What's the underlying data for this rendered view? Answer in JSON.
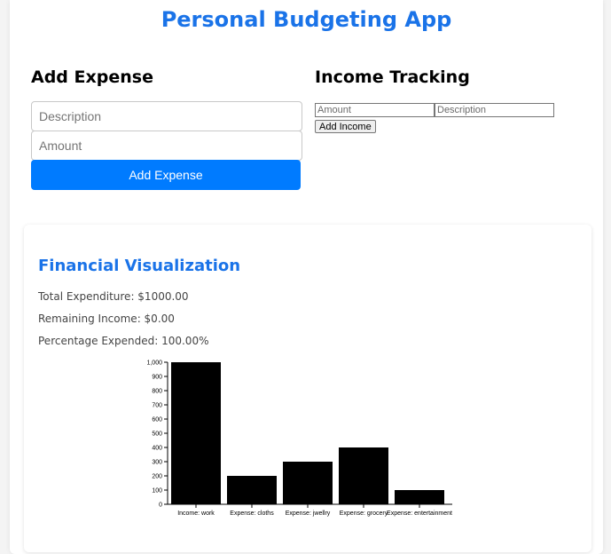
{
  "app": {
    "title": "Personal Budgeting App"
  },
  "expense_form": {
    "heading": "Add Expense",
    "description_placeholder": "Description",
    "amount_placeholder": "Amount",
    "submit_label": "Add Expense",
    "button_color": "#007bff"
  },
  "income_form": {
    "heading": "Income Tracking",
    "amount_placeholder": "Amount",
    "description_placeholder": "Description",
    "submit_label": "Add Income"
  },
  "visualization": {
    "heading": "Financial Visualization",
    "total_expenditure": "Total Expenditure: $1000.00",
    "remaining_income": "Remaining Income: $0.00",
    "percentage_expended": "Percentage Expended: 100.00%"
  },
  "colors": {
    "accent": "#1a73e8",
    "bar": "#000000"
  },
  "chart_data": {
    "type": "bar",
    "categories": [
      "Income: work",
      "Expense: cloths",
      "Expense: jwellry",
      "Expense: grocery",
      "Expense: entertainment"
    ],
    "values": [
      1000,
      200,
      300,
      400,
      100
    ],
    "ylim": [
      0,
      1000
    ],
    "yticks": [
      0,
      100,
      200,
      300,
      400,
      500,
      600,
      700,
      800,
      900,
      1000
    ],
    "ytick_labels": [
      "0",
      "100",
      "200",
      "300",
      "400",
      "500",
      "600",
      "700",
      "800",
      "900",
      "1,000"
    ],
    "grid": false,
    "title": "",
    "xlabel": "",
    "ylabel": ""
  }
}
